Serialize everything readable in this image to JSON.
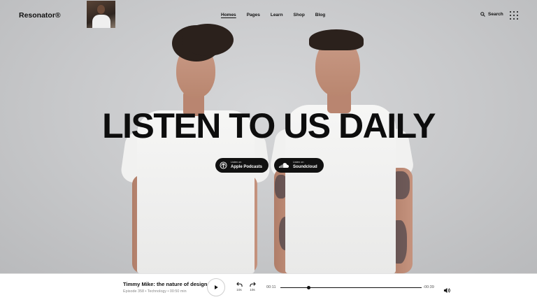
{
  "nav": {
    "logo": "Resonator®",
    "items": [
      {
        "label": "Homes",
        "active": true
      },
      {
        "label": "Pages",
        "active": false
      },
      {
        "label": "Learn",
        "active": false
      },
      {
        "label": "Shop",
        "active": false
      },
      {
        "label": "Blog",
        "active": false
      }
    ],
    "search_label": "Search"
  },
  "hero": {
    "headline": "LISTEN TO US DAILY",
    "badges": [
      {
        "small": "Listen on",
        "big": "Apple Podcasts",
        "icon": "podcast-icon"
      },
      {
        "small": "Listen on",
        "big": "Soundcloud",
        "icon": "soundcloud-icon"
      }
    ]
  },
  "player": {
    "title": "Timmy Mike: the nature of design",
    "meta": "Episode 358 • Technology • 00:50 min",
    "rewind_label": "10s",
    "forward_label": "10s",
    "time_elapsed": "00:11",
    "time_remaining": "-00:39",
    "progress": 0.2
  }
}
